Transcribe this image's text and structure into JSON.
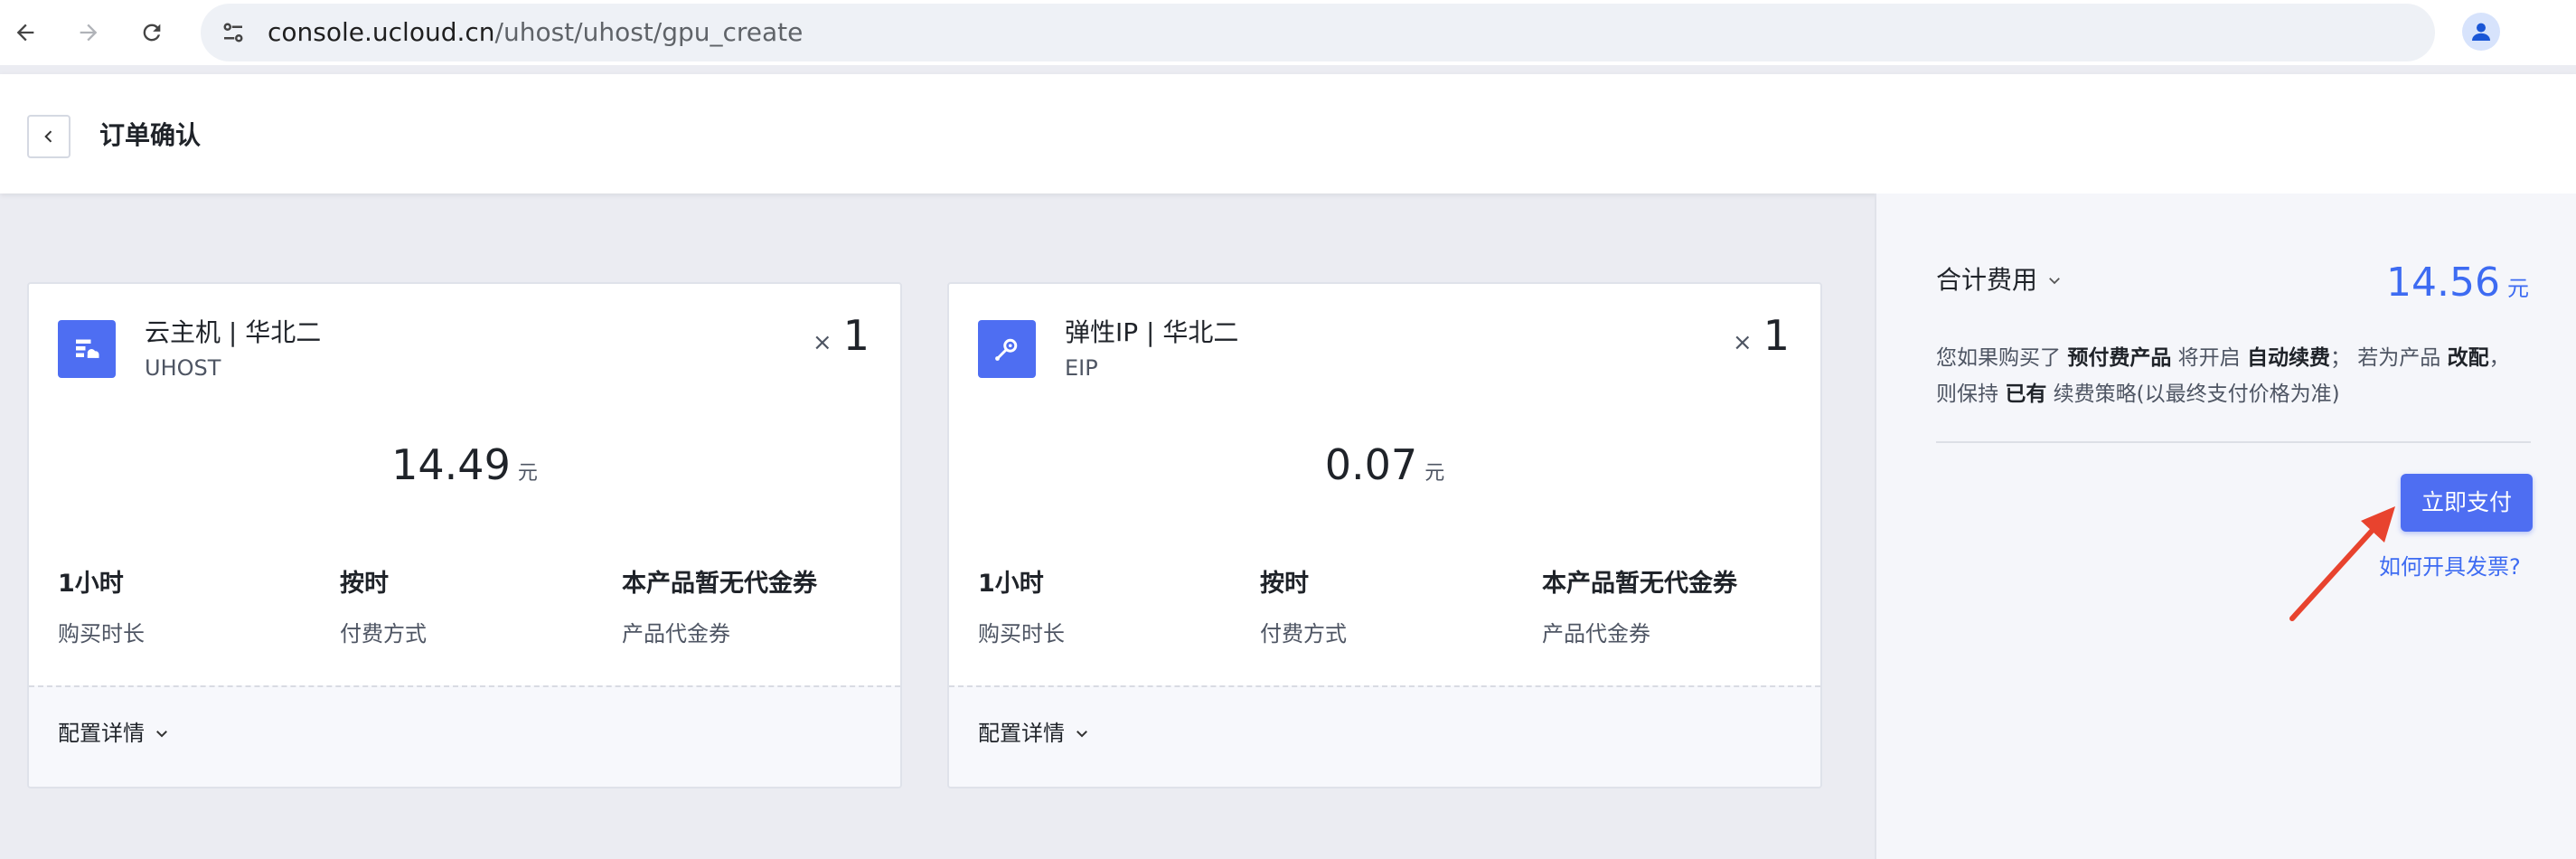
{
  "browser": {
    "url_host": "console.ucloud.cn",
    "url_path": "/uhost/uhost/gpu_create"
  },
  "header": {
    "title": "订单确认"
  },
  "products": [
    {
      "name": "云主机 | 华北二",
      "code": "UHOST",
      "qty_prefix": "×",
      "qty": "1",
      "price": "14.49",
      "unit": "元",
      "specs": [
        {
          "value": "1小时",
          "label": "购买时长"
        },
        {
          "value": "按时",
          "label": "付费方式"
        },
        {
          "value": "本产品暂无代金券",
          "label": "产品代金券"
        }
      ],
      "config_label": "配置详情"
    },
    {
      "name": "弹性IP | 华北二",
      "code": "EIP",
      "qty_prefix": "×",
      "qty": "1",
      "price": "0.07",
      "unit": "元",
      "specs": [
        {
          "value": "1小时",
          "label": "购买时长"
        },
        {
          "value": "按时",
          "label": "付费方式"
        },
        {
          "value": "本产品暂无代金券",
          "label": "产品代金券"
        }
      ],
      "config_label": "配置详情"
    }
  ],
  "summary": {
    "total_label": "合计费用",
    "total_price": "14.56",
    "unit": "元",
    "notice": {
      "t1": "您如果购买了",
      "b1": "预付费产品",
      "t2": "将开启",
      "b2": "自动续费",
      "t3": "； 若为产品",
      "b3": "改配",
      "t4": "， 则保持",
      "b4": "已有",
      "t5": "续费策略(以最终支付价格为准)"
    },
    "pay_button": "立即支付",
    "invoice_link": "如何开具发票?"
  },
  "colors": {
    "accent": "#4e6ef2",
    "price_blue": "#3d6bf2",
    "annotation_arrow": "#e8432e"
  }
}
